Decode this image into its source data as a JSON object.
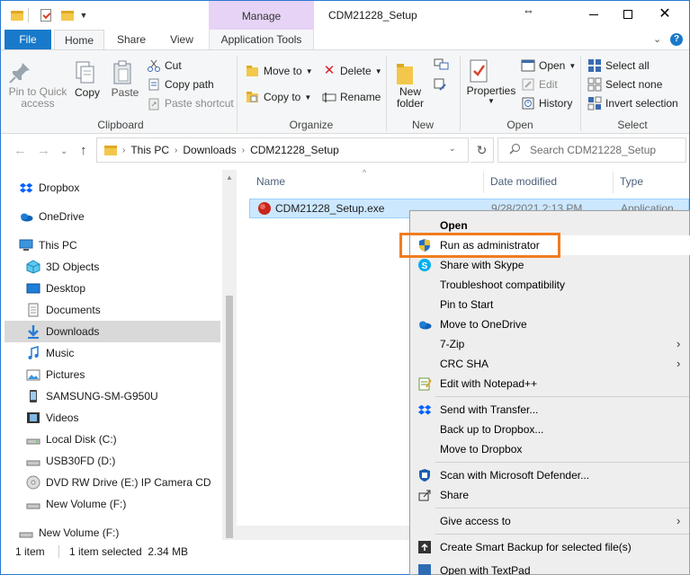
{
  "titlebar": {
    "manage_label": "Manage",
    "title": "CDM21228_Setup",
    "cursor_glyph": "⇔",
    "minimize": "—",
    "maximize": "☐",
    "close": "✕"
  },
  "tabs": {
    "file": "File",
    "home": "Home",
    "share": "Share",
    "view": "View",
    "app_tools": "Application Tools",
    "collapse": "⌄",
    "help": "?"
  },
  "ribbon": {
    "clipboard": {
      "label": "Clipboard",
      "pin": "Pin to Quick access",
      "copy": "Copy",
      "paste": "Paste",
      "cut": "Cut",
      "copy_path": "Copy path",
      "paste_shortcut": "Paste shortcut"
    },
    "organize": {
      "label": "Organize",
      "move_to": "Move to",
      "copy_to": "Copy to",
      "delete": "Delete",
      "rename": "Rename"
    },
    "new": {
      "label": "New",
      "new_folder": "New folder"
    },
    "open": {
      "label": "Open",
      "properties": "Properties",
      "open": "Open",
      "edit": "Edit",
      "history": "History"
    },
    "select": {
      "label": "Select",
      "select_all": "Select all",
      "select_none": "Select none",
      "invert": "Invert selection"
    }
  },
  "address": {
    "crumbs": [
      "This PC",
      "Downloads",
      "CDM21228_Setup"
    ],
    "search_placeholder": "Search CDM21228_Setup"
  },
  "nav": {
    "items": [
      {
        "label": "Dropbox",
        "icon": "dropbox-icon"
      },
      {
        "label": "OneDrive",
        "icon": "onedrive-icon"
      },
      {
        "label": "This PC",
        "icon": "pc-icon"
      },
      {
        "label": "3D Objects",
        "icon": "3d-objects-icon"
      },
      {
        "label": "Desktop",
        "icon": "desktop-icon"
      },
      {
        "label": "Documents",
        "icon": "documents-icon"
      },
      {
        "label": "Downloads",
        "icon": "downloads-icon"
      },
      {
        "label": "Music",
        "icon": "music-icon"
      },
      {
        "label": "Pictures",
        "icon": "pictures-icon"
      },
      {
        "label": "SAMSUNG-SM-G950U",
        "icon": "phone-icon"
      },
      {
        "label": "Videos",
        "icon": "videos-icon"
      },
      {
        "label": "Local Disk (C:)",
        "icon": "disk-icon"
      },
      {
        "label": "USB30FD (D:)",
        "icon": "usb-icon"
      },
      {
        "label": "DVD RW Drive (E:)  IP Camera CD",
        "icon": "dvd-icon"
      },
      {
        "label": "New Volume (F:)",
        "icon": "drive-icon"
      },
      {
        "label": "New Volume (F:)",
        "icon": "drive-icon"
      }
    ]
  },
  "files": {
    "columns": {
      "name": "Name",
      "date": "Date modified",
      "type": "Type"
    },
    "rows": [
      {
        "name": "CDM21228_Setup.exe",
        "date": "9/28/2021 2:13 PM",
        "type": "Application"
      }
    ]
  },
  "status": {
    "count": "1 item",
    "selected": "1 item selected  2.34 MB"
  },
  "context_menu": {
    "items": [
      {
        "label": "Open",
        "bold": true
      },
      {
        "label": "Run as administrator",
        "icon": "shield-icon"
      },
      {
        "label": "Share with Skype",
        "icon": "skype-icon"
      },
      {
        "label": "Troubleshoot compatibility"
      },
      {
        "label": "Pin to Start"
      },
      {
        "label": "Move to OneDrive",
        "icon": "onedrive-icon"
      },
      {
        "label": "7-Zip",
        "submenu": true
      },
      {
        "label": "CRC SHA",
        "submenu": true
      },
      {
        "label": "Edit with Notepad++",
        "icon": "notepadpp-icon"
      },
      {
        "label": "Send with Transfer...",
        "icon": "dropbox-icon"
      },
      {
        "label": "Back up to Dropbox..."
      },
      {
        "label": "Move to Dropbox"
      },
      {
        "label": "Scan with Microsoft Defender...",
        "icon": "defender-icon"
      },
      {
        "label": "Share",
        "icon": "share-icon"
      },
      {
        "label": "Give access to",
        "submenu": true
      },
      {
        "label": "Create Smart Backup for selected file(s)",
        "icon": "backup-icon"
      },
      {
        "label": "Open with TextPad",
        "icon": "textpad-icon"
      }
    ],
    "submenu_arrow": "›"
  },
  "colors": {
    "accent": "#1979ca",
    "manage_tab": "#e6d3f5",
    "selection": "#cce8ff",
    "highlight_box": "#f07c1f"
  }
}
